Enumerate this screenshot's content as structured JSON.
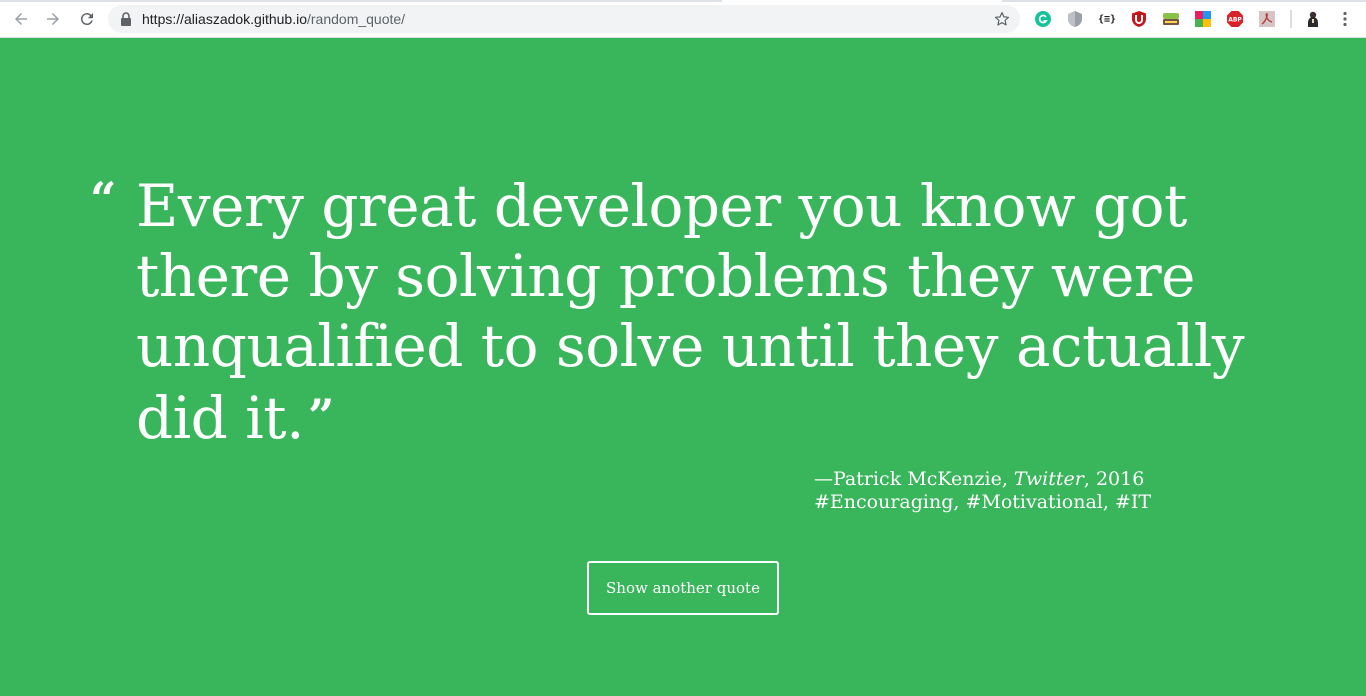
{
  "browser": {
    "url_host": "https://aliaszadok.github.io",
    "url_path": "/random_quote/",
    "nav": {
      "back_icon": "back-arrow-icon",
      "forward_icon": "forward-arrow-icon",
      "reload_icon": "reload-icon"
    },
    "extensions": [
      {
        "name": "grammarly-extension-icon",
        "color": "#15c39a",
        "glyph": "G"
      },
      {
        "name": "shield-extension-icon",
        "color": "#9aa0a6",
        "glyph": ""
      },
      {
        "name": "json-formatter-extension-icon",
        "color": "#202124",
        "glyph": "{≡}"
      },
      {
        "name": "ublock-extension-icon",
        "color": "#c4161c",
        "glyph": ""
      },
      {
        "name": "toolbar-extension-icon",
        "color": "#8bc34a",
        "glyph": ""
      },
      {
        "name": "colorful-extension-icon",
        "color": "#e91e63",
        "glyph": ""
      },
      {
        "name": "adblock-plus-extension-icon",
        "color": "#d8232a",
        "glyph": "ABP"
      },
      {
        "name": "pdf-extension-icon",
        "color": "#b0413e",
        "glyph": ""
      },
      {
        "name": "profile-avatar-icon",
        "color": "#3c2f2f",
        "glyph": ""
      },
      {
        "name": "more-menu-icon",
        "color": "#5f6368",
        "glyph": "⋮"
      }
    ]
  },
  "theme": {
    "background": "#39b55b",
    "text": "#ffffff"
  },
  "quote": {
    "open_mark": "“",
    "text": "Every great developer you know got there by solving problems they were unqualified to solve until they actually did it.",
    "close_mark": "”",
    "attribution_prefix": "—Patrick McKenzie, ",
    "source": "Twitter",
    "year_suffix": ", 2016",
    "tags": "#Encouraging, #Motivational, #IT"
  },
  "actions": {
    "show_another_label": "Show another quote"
  }
}
